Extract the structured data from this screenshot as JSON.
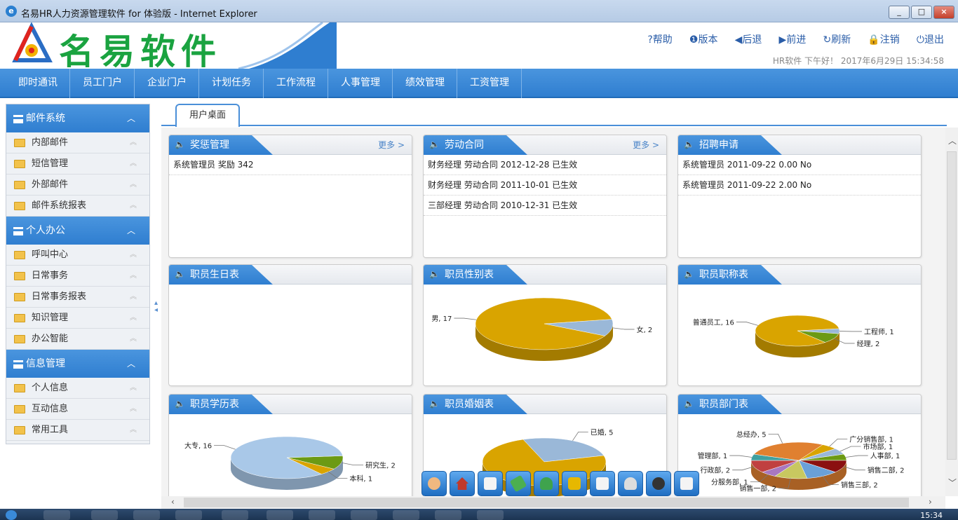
{
  "window": {
    "title": "名易HR人力资源管理软件 for 体验版 - Internet Explorer"
  },
  "header": {
    "logo_text": "名易软件",
    "links": [
      "?帮助",
      "❶版本",
      "◀后退",
      "▶前进",
      "↻刷新",
      "🔒注销",
      "⏻退出"
    ],
    "greeting": "HR软件 下午好！ 2017年6月29日 15:34:58"
  },
  "menu": [
    "即时通讯",
    "员工门户",
    "企业门户",
    "计划任务",
    "工作流程",
    "人事管理",
    "绩效管理",
    "工资管理"
  ],
  "sidebar": [
    {
      "title": "邮件系统",
      "items": [
        "内部邮件",
        "短信管理",
        "外部邮件",
        "邮件系统报表"
      ]
    },
    {
      "title": "个人办公",
      "items": [
        "呼叫中心",
        "日常事务",
        "日常事务报表",
        "知识管理",
        "办公智能"
      ]
    },
    {
      "title": "信息管理",
      "items": [
        "个人信息",
        "互动信息",
        "常用工具"
      ]
    }
  ],
  "tab": "用户桌面",
  "panels": {
    "jiangcheng": {
      "title": "奖惩管理",
      "more": "更多 >",
      "rows": [
        "系统管理员 奖励 342"
      ]
    },
    "laodong": {
      "title": "劳动合同",
      "more": "更多 >",
      "rows": [
        "财务经理 劳动合同 2012-12-28 已生效",
        "财务经理 劳动合同 2011-10-01 已生效",
        "三部经理 劳动合同 2010-12-31 已生效"
      ]
    },
    "zhaopin": {
      "title": "招聘申请",
      "rows": [
        "系统管理员 2011-09-22 0.00 No",
        "系统管理员 2011-09-22 2.00 No"
      ]
    },
    "shengri": {
      "title": "职员生日表"
    },
    "xingbie": {
      "title": "职员性别表"
    },
    "zhicheng": {
      "title": "职员职称表"
    },
    "xueli": {
      "title": "职员学历表"
    },
    "hunyin": {
      "title": "职员婚姻表"
    },
    "bumen": {
      "title": "职员部门表"
    }
  },
  "chart_data": [
    {
      "type": "pie",
      "categories": [
        "女",
        "男"
      ],
      "values": [
        2,
        17
      ],
      "labels": [
        "女, 2",
        "男, 17"
      ],
      "colors": [
        "#9ab8d8",
        "#d9a400"
      ]
    },
    {
      "type": "pie",
      "categories": [
        "工程师",
        "经理",
        "普通员工"
      ],
      "values": [
        1,
        2,
        16
      ],
      "labels": [
        "工程师, 1",
        "经理, 2",
        "普通员工, 16"
      ],
      "colors": [
        "#9ab8d8",
        "#6c9a14",
        "#d9a400"
      ]
    },
    {
      "type": "pie",
      "categories": [
        "研究生",
        "本科",
        "大专"
      ],
      "values": [
        2,
        1,
        16
      ],
      "labels": [
        "研究生, 2",
        "本科, 1",
        "大专, 16"
      ],
      "colors": [
        "#6c9a14",
        "#d9a400",
        "#a9c8e8"
      ]
    },
    {
      "type": "pie",
      "categories": [
        "已婚"
      ],
      "values": [
        5
      ],
      "labels": [
        "已婚, 5"
      ],
      "colors": [
        "#9ab8d8",
        "#d9a400"
      ]
    },
    {
      "type": "pie",
      "categories": [
        "广分销售部",
        "市场部",
        "人事部",
        "销售二部",
        "销售三部",
        "销售一部",
        "分服务部",
        "行政部",
        "管理部",
        "总经办"
      ],
      "values": [
        1,
        1,
        1,
        2,
        2,
        2,
        1,
        2,
        1,
        5
      ],
      "labels": [
        "广分销售部, 1",
        "市场部, 1",
        "人事部, 1",
        "销售二部, 2",
        "销售三部, 2",
        "销售一部, 2",
        "分服务部, 1",
        "行政部, 2",
        "管理部, 1",
        "总经办, 5"
      ],
      "colors": [
        "#d9a400",
        "#9ab8d8",
        "#6c9a14",
        "#8b1010",
        "#6aa0d8",
        "#c8c860",
        "#a878c0",
        "#c04040",
        "#40a0a0",
        "#e08030"
      ]
    }
  ],
  "dock_icons": [
    "person-icon",
    "home-icon",
    "edit-icon",
    "tag-icon",
    "users-icon",
    "lock-icon",
    "document-icon",
    "money-icon",
    "agent-icon",
    "chart-icon"
  ],
  "taskbar": {
    "clock": "15:34"
  }
}
